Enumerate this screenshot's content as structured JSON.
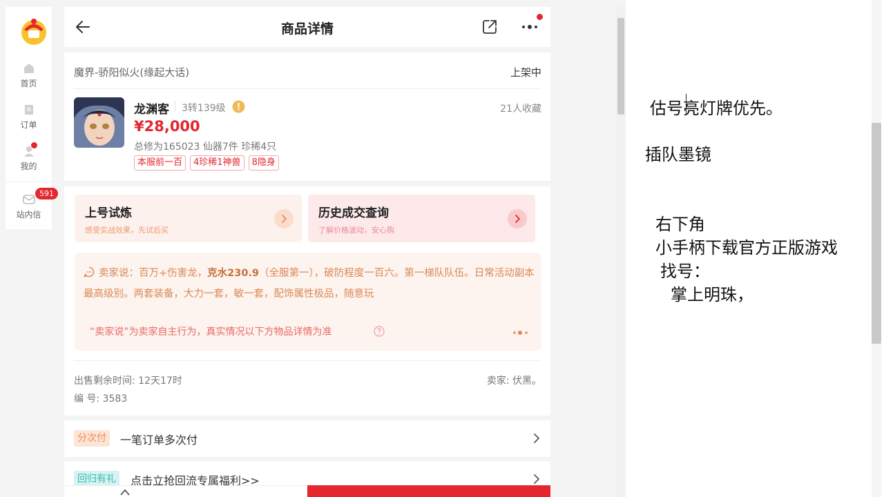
{
  "sidebar": {
    "items": [
      {
        "label": "首页",
        "icon": "home-icon"
      },
      {
        "label": "订单",
        "icon": "order-icon"
      },
      {
        "label": "我的",
        "icon": "user-icon"
      },
      {
        "label": "站内信",
        "icon": "mail-icon"
      }
    ],
    "mail_badge": "591"
  },
  "header": {
    "title": "商品详情"
  },
  "product": {
    "server": "魔界-骄阳似火(缘起大话)",
    "status": "上架中",
    "name": "龙渊客",
    "level": "3转139级",
    "favorites": "21人收藏",
    "price": "¥28,000",
    "stats": "总修为165023  仙器7件  珍稀4只",
    "tags": [
      "本服前一百",
      "4珍稀1神兽",
      "8隐身"
    ]
  },
  "promos": [
    {
      "title": "上号试炼",
      "subtitle": "感受实战效果，先试后买"
    },
    {
      "title": "历史成交查询",
      "subtitle": "了解价格波动，安心购"
    }
  ],
  "seller_says": {
    "prefix": "卖家说：百万+伤害龙，",
    "highlight": "克水230.9",
    "suffix": "（全服第一），破防程度一百六。第一梯队队伍。日常活动副本最高级别。两套装备，大力一套，敏一套，配饰属性极品，随意玩",
    "note": "“卖家说”为卖家自主行为，真实情况以下方物品详情为准"
  },
  "meta": {
    "remaining": "出售剩余时间: 12天17时",
    "seller": "卖家: 伏黑。",
    "serial": "编 号: 3583"
  },
  "rows": [
    {
      "tag": "分次付",
      "text": "一笔订单多次付"
    },
    {
      "tag": "回归有礼",
      "text": "点击立抢回流专属福利>>"
    }
  ],
  "notes": {
    "line1": "估号亮灯牌优先。",
    "line2": "插队墨镜",
    "line3": "右下角",
    "line4": "小手柄下载官方正版游戏",
    "line5": "找号：",
    "line6": "掌上明珠，"
  },
  "colors": {
    "accent_red": "#e5262e",
    "seller_text": "#d98a56",
    "tag_orange": "#ef8c57",
    "tag_teal": "#3cb9ae"
  }
}
